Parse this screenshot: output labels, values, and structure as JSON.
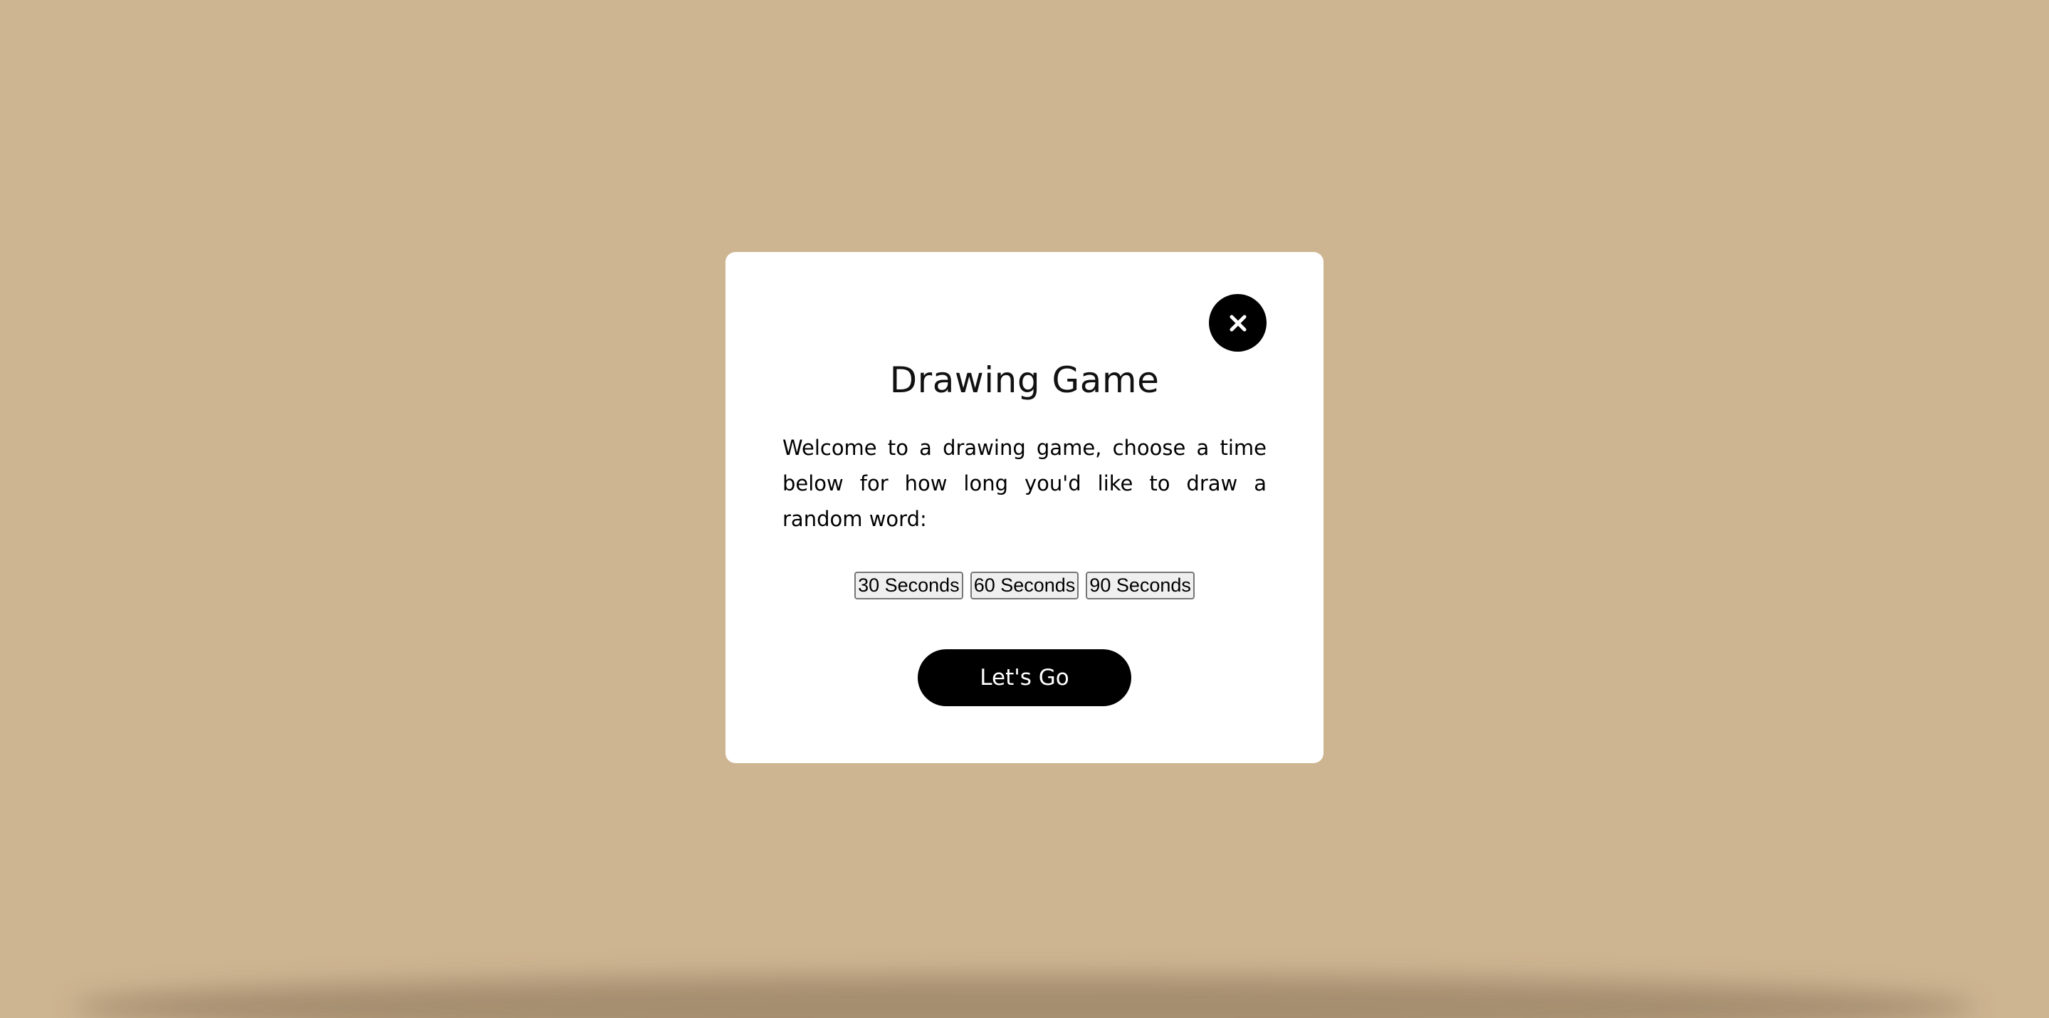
{
  "modal": {
    "close_icon": "close-icon",
    "title": "Drawing Game",
    "description": "Welcome to a drawing game, choose a time below for how long you'd like to draw a random word:",
    "time_options": [
      "30 Seconds",
      "60 Seconds",
      "90 Seconds"
    ],
    "start_label": "Let's Go"
  },
  "colors": {
    "background": "#ceb592",
    "modal": "#ffffff",
    "accent": "#000000"
  }
}
